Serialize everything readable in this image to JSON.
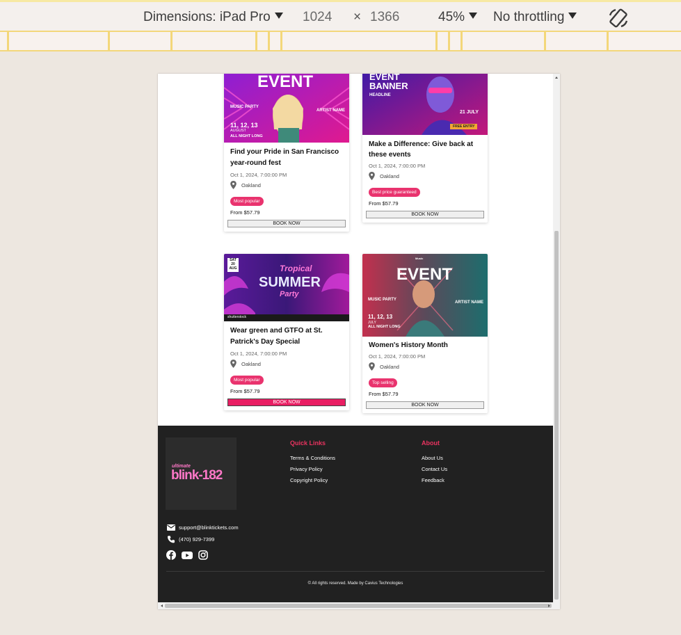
{
  "devtools": {
    "dimensions_label": "Dimensions: iPad Pro",
    "width": "1024",
    "times": "×",
    "height": "1366",
    "zoom": "45%",
    "throttling": "No throttling",
    "rotate_icon": "rotate-device-icon"
  },
  "events": [
    {
      "banner": {
        "headline": "EVENT",
        "sub1": "MUSIC PARTY",
        "sub2": "ARTIST NAME",
        "dates": "11, 12, 13",
        "month": "AUGUST",
        "tag": "ALL NIGHT LONG"
      },
      "title": "Find your Pride in San Francisco year-round fest",
      "date": "Oct 1, 2024, 7:00:00 PM",
      "location": "Oakland",
      "badge": "Most popular",
      "price": "From $57.79",
      "button": "BOOK NOW"
    },
    {
      "banner": {
        "headline": "EVENT BANNER",
        "sub1": "HEADLINE",
        "dates": "21 JULY",
        "tag": "FREE ENTRY"
      },
      "title": "Make a Difference: Give back at these events",
      "date": "Oct 1, 2024, 7:00:00 PM",
      "location": "Oakland",
      "badge": "Best price guaranteed",
      "price": "From $57.79",
      "button": "BOOK NOW"
    },
    {
      "banner": {
        "headline": "SUMMER",
        "sub1": "Tropical",
        "sub2": "Party",
        "dates": "SAT 20 AUG",
        "tag": "shutterstock"
      },
      "title": "Wear green and GTFO at St. Patrick's Day Special",
      "date": "Oct 1, 2024, 7:00:00 PM",
      "location": "Oakland",
      "badge": "Most popular",
      "price": "From $57.79",
      "button": "BOOK NOW"
    },
    {
      "banner": {
        "headline": "EVENT",
        "sub1": "MUSIC PARTY",
        "sub2": "ARTIST NAME",
        "dates": "11, 12, 13",
        "month": "JULY",
        "tag": "ALL NIGHT LONG",
        "top": "Music"
      },
      "title": "Women's History Month",
      "date": "Oct 1, 2024, 7:00:00 PM",
      "location": "Oakland",
      "badge": "Top selling",
      "price": "From $57.79",
      "button": "BOOK NOW"
    }
  ],
  "footer": {
    "logo_text": "blink-182",
    "logo_small": "ultimate",
    "quick_links_heading": "Quick Links",
    "quick_links": [
      "Terms & Conditions",
      "Privacy Policy",
      "Copyright Policy"
    ],
    "about_heading": "About",
    "about_links": [
      "About Us",
      "Contact Us",
      "Feedback"
    ],
    "email": "support@blinktickets.com",
    "phone": "(470) 929-7399",
    "social_icons": [
      "facebook-icon",
      "youtube-icon",
      "instagram-icon"
    ],
    "copyright": "© All rights reserved. Made by Cavius Technologies"
  },
  "colors": {
    "accent": "#e91e63",
    "badge": "#e9336e",
    "footer_bg": "#212121",
    "footer_heading": "#e8335f"
  }
}
